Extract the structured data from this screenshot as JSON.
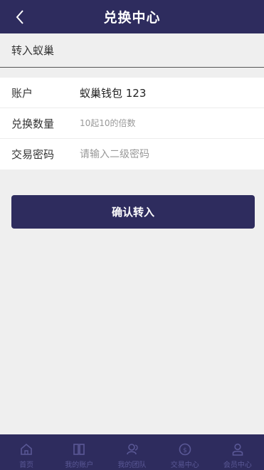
{
  "header": {
    "title": "兑换中心",
    "back_icon": "chevron-left-icon"
  },
  "section": {
    "label": "转入蚁巢"
  },
  "form": {
    "account_label": "账户",
    "account_value": "蚁巢钱包 123",
    "amount_label": "兑换数量",
    "amount_placeholder": "10起10的倍数",
    "password_label": "交易密码",
    "password_placeholder": "请输入二级密码"
  },
  "confirm_label": "确认转入",
  "tabbar": {
    "items": [
      {
        "label": "首页",
        "icon": "home-icon"
      },
      {
        "label": "我的账户",
        "icon": "book-icon"
      },
      {
        "label": "我的团队",
        "icon": "team-icon"
      },
      {
        "label": "交易中心",
        "icon": "coin-icon"
      },
      {
        "label": "会员中心",
        "icon": "user-icon"
      }
    ]
  },
  "colors": {
    "primary": "#2e2c5e",
    "tab_inactive": "#5a5896",
    "background": "#efefef"
  }
}
